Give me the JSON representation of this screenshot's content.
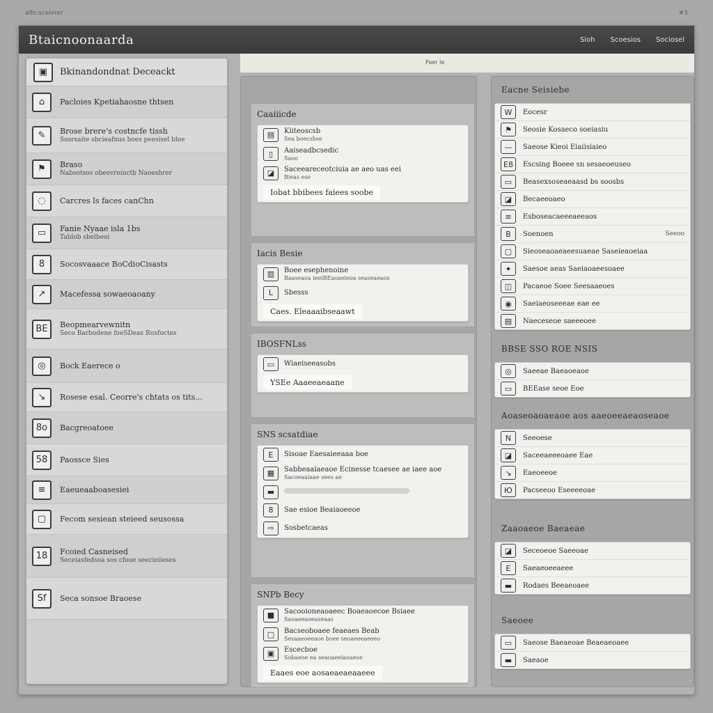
{
  "corner": {
    "left": "a8s:sceivrer",
    "right": "#3"
  },
  "window": {
    "title": "Btaicnoonaarda",
    "nav": [
      "Sioh",
      "Scoesios",
      "Sociosel"
    ]
  },
  "topstrip": {
    "label": "Paer le"
  },
  "sidebar": {
    "header": "Bkinandondnat Deceackt",
    "items": [
      {
        "icon": "photo-icon",
        "glyph": "⌂",
        "label": "Pacloies Kpetiahaosne thtsen",
        "sub": ""
      },
      {
        "icon": "pen-icon",
        "glyph": "✎",
        "label": "Brose brere's costncfe tissh",
        "sub": "Sosrsaite sbcieafnus boes peesisel bloe"
      },
      {
        "icon": "flag-icon",
        "glyph": "⚑",
        "label": "Braso",
        "sub": "Nabsotsos obeovreinctb Naoeshrer"
      },
      {
        "icon": "chat-icon",
        "glyph": "◌",
        "label": "Carcres ls faces canChn",
        "sub": ""
      },
      {
        "icon": "card-icon",
        "glyph": "▭",
        "label": "Fanie Nyaae isla 1bs",
        "sub": "Tablob sbelbeoi"
      },
      {
        "icon": "number-icon",
        "glyph": "8",
        "label": "Socosvaaace BoCdioCisasts",
        "sub": ""
      },
      {
        "icon": "arrow-icon",
        "glyph": "↗",
        "label": "Macefessa sowaeoaoany",
        "sub": ""
      },
      {
        "icon": "badge-icon",
        "glyph": "BE",
        "label": "Beopmearvewnitn",
        "sub": "Seco Barbodene foeSDeas Rusfoctes"
      },
      {
        "icon": "spiral-icon",
        "glyph": "◎",
        "label": "Bock Eaerece o",
        "sub": ""
      },
      {
        "icon": "link-icon",
        "glyph": "↘",
        "label": "Rosese esal. Ceorre's chtats os tits...",
        "sub": ""
      },
      {
        "icon": "tag-icon",
        "glyph": "8o",
        "label": "Bacgreoatoee",
        "sub": ""
      },
      {
        "icon": "list-icon",
        "glyph": "58",
        "label": "Paossce  Sies",
        "sub": ""
      },
      {
        "icon": "grid-icon",
        "glyph": "≡",
        "label": "Eaeueaaboasesiei",
        "sub": ""
      },
      {
        "icon": "box-icon",
        "glyph": "▢",
        "label": "Fecom sesiean steieed seusossa",
        "sub": ""
      },
      {
        "icon": "date-icon",
        "glyph": "18",
        "label": "Fcoied Casneised",
        "sub": "Seceiasfedsoa sos cfeoe seecioiieses"
      },
      {
        "icon": "check-icon",
        "glyph": "Sf",
        "label": "Seca sonsoe Braoese",
        "sub": ""
      }
    ]
  },
  "middle": {
    "groups": [
      {
        "title": "Caaiiicde",
        "rows": [
          {
            "icon": "book-icon",
            "glyph": "▤",
            "label": "Kiiteoscsb",
            "sub": "Sea  boecsbse"
          },
          {
            "icon": "frame-icon",
            "glyph": "▯",
            "label": "Aaiseadbcsedic",
            "sub": "Saoo"
          },
          {
            "icon": "photo-icon",
            "glyph": "◪",
            "label": "Saceeareceotciuia ae aeo uas eei",
            "sub": "Bieas ese"
          }
        ],
        "footer": "Iobat bbibees faiees soobe"
      },
      {
        "title": "Iacis Besie",
        "rows": [
          {
            "icon": "chart-icon",
            "glyph": "▥",
            "label": "Boee esephenoine",
            "sub": "Baaseaoa ieeiBEaoaeieoa seaseaeaos"
          },
          {
            "icon": "list-icon",
            "glyph": "L",
            "label": "Sbesss",
            "sub": ""
          }
        ],
        "footer": "Caes. Eleaaaibseaawt"
      },
      {
        "title": "IBOSFNLss",
        "rows": [
          {
            "icon": "card-icon",
            "glyph": "▭",
            "label": "Wiaeiseeasobs",
            "sub": ""
          }
        ],
        "footer": "YSEe Aaaeeaeaane"
      },
      {
        "title": "SNS scsatdiae",
        "rows": [
          {
            "icon": "number-icon",
            "glyph": "E",
            "label": "Sisoae Eaesaieeaaa boe",
            "sub": ""
          },
          {
            "icon": "photo-icon",
            "glyph": "▦",
            "label": "Sabbeaaiaeaoe Ecinesse tcaesee ae iaee aoe",
            "sub": "Sacoeaaiaae sees ae"
          },
          {
            "icon": "bar-icon",
            "glyph": "▬",
            "label": "",
            "sub": ""
          },
          {
            "icon": "tag-icon",
            "glyph": "8",
            "label": "Sae esioe Beaiaoeeoe",
            "sub": ""
          },
          {
            "icon": "arrow-icon",
            "glyph": "⇨",
            "label": "Sosbetcaeas",
            "sub": ""
          }
        ],
        "footer": ""
      },
      {
        "title": "SNPb Becy",
        "rows": [
          {
            "icon": "square-icon",
            "glyph": "■",
            "label": "Sacooioneaoaeec Boaeaoecoe Bsiaee",
            "sub": "Saoaeeaoeaseaas"
          },
          {
            "icon": "square-icon",
            "glyph": "□",
            "label": "Bacseoboaee feaeaes Beab",
            "sub": "Sesaaeoeeaoe boee seoaeeeaeeeo"
          },
          {
            "icon": "device-icon",
            "glyph": "▣",
            "label": "Escecboe",
            "sub": "Sobaeoe ea seaoaeeiaoaeoe"
          }
        ],
        "footer": "Eaaes eoe aosaeaeaeaaeee"
      }
    ]
  },
  "right": {
    "groups": [
      {
        "title": "Eacne Seisiebe",
        "rows": [
          {
            "icon": "tag-icon",
            "glyph": "W",
            "label": "Eocesr",
            "right": ""
          },
          {
            "icon": "flag-icon",
            "glyph": "⚑",
            "label": "Seosie Kosaeco soeiasiu",
            "right": ""
          },
          {
            "icon": "line-icon",
            "glyph": "—",
            "label": "Saeose Kieoi Eiaiisiaieo",
            "right": ""
          },
          {
            "icon": "number-icon",
            "glyph": "E8",
            "label": "Escsing Boeee sn sesaeoeuseo",
            "right": ""
          },
          {
            "icon": "card-icon",
            "glyph": "▭",
            "label": "Beasexsoseaeaasd bs soosbs",
            "right": ""
          },
          {
            "icon": "photo-icon",
            "glyph": "◪",
            "label": "Becaeeoaeo",
            "right": ""
          },
          {
            "icon": "list-icon",
            "glyph": "≡",
            "label": "Esboseacaeeeaeeaos",
            "right": ""
          },
          {
            "icon": "tag-icon",
            "glyph": "B",
            "label": "Soenoen",
            "right": "Seeoo"
          },
          {
            "icon": "box-icon",
            "glyph": "▢",
            "label": "Sieoseaoaeaeesuaeae Saseieaoeiaa",
            "right": ""
          },
          {
            "icon": "star-icon",
            "glyph": "✦",
            "label": "Saesoe aeas Saeiaoaeesoaee",
            "right": ""
          },
          {
            "icon": "photo-icon",
            "glyph": "◫",
            "label": "Pacaeoe Soee Seesaaeoes",
            "right": ""
          },
          {
            "icon": "device-icon",
            "glyph": "◉",
            "label": "Saeiaeoseeeae eae ee",
            "right": ""
          },
          {
            "icon": "chat-icon",
            "glyph": "▤",
            "label": "Naeceseoe saeeeoee",
            "right": ""
          }
        ]
      },
      {
        "title": "BBSE SSO ROE NSIS",
        "rows": [
          {
            "icon": "spiral-icon",
            "glyph": "◎",
            "label": "Saeeae Baeaoeaoe",
            "right": ""
          },
          {
            "icon": "card-icon",
            "glyph": "▭",
            "label": "BEEase seoe Eoe",
            "right": ""
          }
        ]
      },
      {
        "title": "Aoaseoaoaeaoe aos aaeoeeaeaoseaoe",
        "rows": [
          {
            "icon": "number-icon",
            "glyph": "N",
            "label": "Seeoese",
            "right": ""
          },
          {
            "icon": "photo-icon",
            "glyph": "◪",
            "label": "Saceeaeeeoaee Eae",
            "right": ""
          },
          {
            "icon": "arrow-icon",
            "glyph": "↘",
            "label": "Eaeoeeoe",
            "right": ""
          },
          {
            "icon": "tag-icon",
            "glyph": "Ю",
            "label": "Pacseeoo Eseeeeoae",
            "right": ""
          }
        ]
      },
      {
        "title": "Zaaoaeoe Baeaeae",
        "rows": [
          {
            "icon": "photo-icon",
            "glyph": "◪",
            "label": "Seceoeoe Saeeoae",
            "right": ""
          },
          {
            "icon": "number-icon",
            "glyph": "E",
            "label": "Saeaeoeeaeee",
            "right": ""
          },
          {
            "icon": "list-icon",
            "glyph": "▬",
            "label": "Rodaes Beeaeoaee",
            "right": ""
          }
        ]
      },
      {
        "title": "Saeoee",
        "rows": [
          {
            "icon": "card-icon",
            "glyph": "▭",
            "label": "Saeose Baeaeoae Beaeaeoaee",
            "right": ""
          },
          {
            "icon": "bar-icon",
            "glyph": "▬",
            "label": "Saeaoe",
            "right": ""
          }
        ]
      }
    ]
  }
}
